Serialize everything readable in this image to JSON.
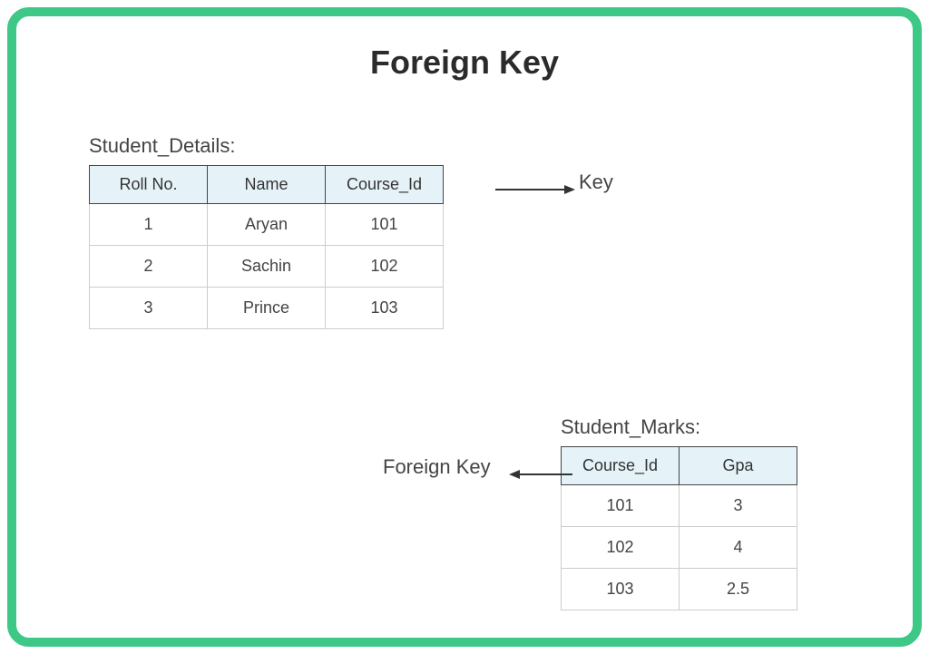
{
  "title": "Foreign Key",
  "table1": {
    "label": "Student_Details:",
    "headers": [
      "Roll No.",
      "Name",
      "Course_Id"
    ],
    "rows": [
      [
        "1",
        "Aryan",
        "101"
      ],
      [
        "2",
        "Sachin",
        "102"
      ],
      [
        "3",
        "Prince",
        "103"
      ]
    ]
  },
  "table2": {
    "label": "Student_Marks:",
    "headers": [
      "Course_Id",
      "Gpa"
    ],
    "rows": [
      [
        "101",
        "3"
      ],
      [
        "102",
        "4"
      ],
      [
        "103",
        "2.5"
      ]
    ]
  },
  "annotations": {
    "key_label": "Key",
    "fk_label": "Foreign Key"
  }
}
